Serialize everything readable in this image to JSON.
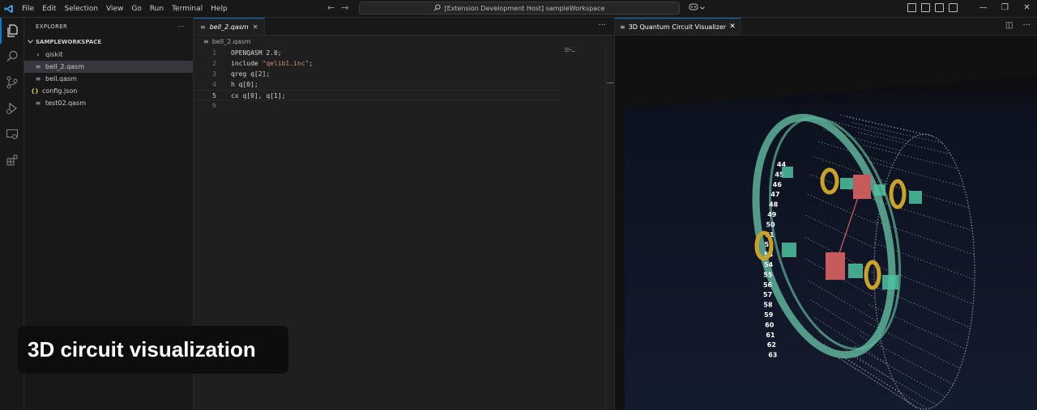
{
  "menu": [
    "File",
    "Edit",
    "Selection",
    "View",
    "Go",
    "Run",
    "Terminal",
    "Help"
  ],
  "command_center": "[Extension Development Host] sampleWorkspace",
  "icons": {
    "logo": "vscode-logo-icon",
    "back": "arrow-left-icon",
    "forward": "arrow-right-icon",
    "search": "search-icon",
    "copilot": "copilot-icon"
  },
  "nav": {
    "back": "←",
    "forward": "→"
  },
  "window_glyphs": {
    "minimize": "—",
    "restore": "❐",
    "close": "✕"
  },
  "sidebar": {
    "title": "EXPLORER",
    "more": "···",
    "workspace": "SAMPLEWORKSPACE",
    "items": [
      {
        "label": "qiskit",
        "type": "folder",
        "glyph": "›"
      },
      {
        "label": "bell_2.qasm",
        "type": "file",
        "glyph": "≡",
        "selected": true
      },
      {
        "label": "bell.qasm",
        "type": "file",
        "glyph": "≡"
      },
      {
        "label": "config.json",
        "type": "json",
        "glyph": "{}"
      },
      {
        "label": "test02.qasm",
        "type": "file",
        "glyph": "≡"
      }
    ]
  },
  "editor": {
    "tab_label": "bell_2.qasm",
    "tab_close": "✕",
    "more": "···",
    "breadcrumb": "bell_2.qasm",
    "file_glyph": "≡",
    "current_line": 5,
    "lines": [
      {
        "n": "1",
        "text": "OPENQASM 2.0;"
      },
      {
        "n": "2",
        "pre": "include ",
        "str": "\"qelib1.inc\"",
        "post": ";"
      },
      {
        "n": "3",
        "text": "qreg q[2];"
      },
      {
        "n": "4",
        "text": "h q[0];"
      },
      {
        "n": "5",
        "text": "cx q[0], q[1];"
      },
      {
        "n": "6",
        "text": ""
      }
    ]
  },
  "visualizer": {
    "tab_label": "3D Quantum Circuit Visualizer",
    "tab_close": "✕",
    "split_glyph": "◫",
    "more": "···",
    "ring_labels": [
      "44",
      "45",
      "46",
      "47",
      "48",
      "49",
      "50",
      "51",
      "52",
      "53",
      "54",
      "55",
      "56",
      "57",
      "58",
      "59",
      "60",
      "61",
      "62",
      "63"
    ],
    "colors": {
      "background": "#0f1626",
      "ring": "#5fb39a",
      "wire": "#e0e0e0",
      "gate_x": "#4ec2a0",
      "gate_h": "#c75a5a",
      "control": "#c9a227",
      "link": "#d9605a"
    }
  },
  "caption": "3D circuit visualization"
}
